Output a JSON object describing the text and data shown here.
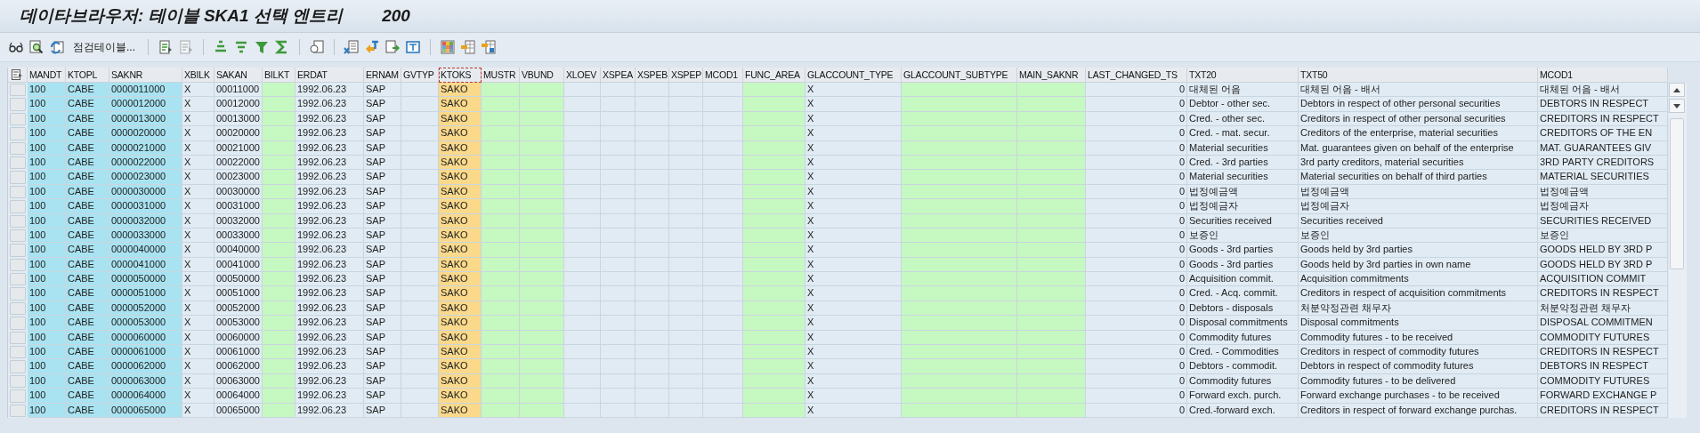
{
  "window": {
    "title": "데이타브라우저: 테이블 SKA1 선택 엔트리",
    "count": "200"
  },
  "toolbar": {
    "check_table_button": "점검테이블..."
  },
  "table": {
    "columns": [
      {
        "label": "MANDT",
        "kind": "key",
        "selected": false
      },
      {
        "label": "KTOPL",
        "kind": "key",
        "selected": false
      },
      {
        "label": "SAKNR",
        "kind": "key",
        "selected": false
      },
      {
        "label": "XBILK",
        "kind": "plain",
        "selected": false
      },
      {
        "label": "SAKAN",
        "kind": "plain",
        "selected": false
      },
      {
        "label": "BILKT",
        "kind": "input",
        "selected": false
      },
      {
        "label": "ERDAT",
        "kind": "plain",
        "selected": false
      },
      {
        "label": "ERNAM",
        "kind": "plain",
        "selected": false
      },
      {
        "label": "GVTYP",
        "kind": "plain",
        "selected": false
      },
      {
        "label": "KTOKS",
        "kind": "emphasized",
        "selected": true
      },
      {
        "label": "MUSTR",
        "kind": "input",
        "selected": false
      },
      {
        "label": "VBUND",
        "kind": "input",
        "selected": false
      },
      {
        "label": "XLOEV",
        "kind": "plain",
        "selected": false
      },
      {
        "label": "XSPEA",
        "kind": "plain",
        "selected": false
      },
      {
        "label": "XSPEB",
        "kind": "plain",
        "selected": false
      },
      {
        "label": "XSPEP",
        "kind": "plain",
        "selected": false
      },
      {
        "label": "MCOD1",
        "kind": "plain",
        "selected": false
      },
      {
        "label": "FUNC_AREA",
        "kind": "input",
        "selected": false
      },
      {
        "label": "GLACCOUNT_TYPE",
        "kind": "plain",
        "selected": false
      },
      {
        "label": "GLACCOUNT_SUBTYPE",
        "kind": "input",
        "selected": false
      },
      {
        "label": "MAIN_SAKNR",
        "kind": "input",
        "selected": false
      },
      {
        "label": "LAST_CHANGED_TS",
        "kind": "plain",
        "selected": false
      },
      {
        "label": "TXT20",
        "kind": "plain",
        "selected": false
      },
      {
        "label": "TXT50",
        "kind": "plain",
        "selected": false
      },
      {
        "label": "MCOD1",
        "kind": "plain",
        "selected": false
      }
    ],
    "rows": [
      {
        "mandt": "100",
        "ktopl": "CABE",
        "saknr": "0000011000",
        "xbilk": "X",
        "sakan": "00011000",
        "erdat": "1992.06.23",
        "ernam": "SAP",
        "ktoks": "SAKO",
        "glaccount_type": "X",
        "last_changed_ts": "0",
        "txt20": "대체된 어음",
        "txt50": "대체된 어음 - 배서",
        "mcod1": "대체된 어음 - 배서"
      },
      {
        "mandt": "100",
        "ktopl": "CABE",
        "saknr": "0000012000",
        "xbilk": "X",
        "sakan": "00012000",
        "erdat": "1992.06.23",
        "ernam": "SAP",
        "ktoks": "SAKO",
        "glaccount_type": "X",
        "last_changed_ts": "0",
        "txt20": "Debtor - other sec.",
        "txt50": "Debtors in respect of other personal securities",
        "mcod1": "DEBTORS IN RESPECT"
      },
      {
        "mandt": "100",
        "ktopl": "CABE",
        "saknr": "0000013000",
        "xbilk": "X",
        "sakan": "00013000",
        "erdat": "1992.06.23",
        "ernam": "SAP",
        "ktoks": "SAKO",
        "glaccount_type": "X",
        "last_changed_ts": "0",
        "txt20": "Cred. - other sec.",
        "txt50": "Creditors in respect of other personal securities",
        "mcod1": "CREDITORS IN RESPECT"
      },
      {
        "mandt": "100",
        "ktopl": "CABE",
        "saknr": "0000020000",
        "xbilk": "X",
        "sakan": "00020000",
        "erdat": "1992.06.23",
        "ernam": "SAP",
        "ktoks": "SAKO",
        "glaccount_type": "X",
        "last_changed_ts": "0",
        "txt20": "Cred. - mat. secur.",
        "txt50": "Creditors of the enterprise, material securities",
        "mcod1": "CREDITORS OF THE EN"
      },
      {
        "mandt": "100",
        "ktopl": "CABE",
        "saknr": "0000021000",
        "xbilk": "X",
        "sakan": "00021000",
        "erdat": "1992.06.23",
        "ernam": "SAP",
        "ktoks": "SAKO",
        "glaccount_type": "X",
        "last_changed_ts": "0",
        "txt20": "Material securities",
        "txt50": "Mat. guarantees given on behalf of the enterprise",
        "mcod1": "MAT. GUARANTEES GIV"
      },
      {
        "mandt": "100",
        "ktopl": "CABE",
        "saknr": "0000022000",
        "xbilk": "X",
        "sakan": "00022000",
        "erdat": "1992.06.23",
        "ernam": "SAP",
        "ktoks": "SAKO",
        "glaccount_type": "X",
        "last_changed_ts": "0",
        "txt20": "Cred. - 3rd parties",
        "txt50": "3rd party creditors, material securities",
        "mcod1": "3RD PARTY CREDITORS"
      },
      {
        "mandt": "100",
        "ktopl": "CABE",
        "saknr": "0000023000",
        "xbilk": "X",
        "sakan": "00023000",
        "erdat": "1992.06.23",
        "ernam": "SAP",
        "ktoks": "SAKO",
        "glaccount_type": "X",
        "last_changed_ts": "0",
        "txt20": "Material securities",
        "txt50": "Material securities on behalf of third parties",
        "mcod1": "MATERIAL SECURITIES"
      },
      {
        "mandt": "100",
        "ktopl": "CABE",
        "saknr": "0000030000",
        "xbilk": "X",
        "sakan": "00030000",
        "erdat": "1992.06.23",
        "ernam": "SAP",
        "ktoks": "SAKO",
        "glaccount_type": "X",
        "last_changed_ts": "0",
        "txt20": "법정예금액",
        "txt50": "법정예금액",
        "mcod1": "법정예금액"
      },
      {
        "mandt": "100",
        "ktopl": "CABE",
        "saknr": "0000031000",
        "xbilk": "X",
        "sakan": "00031000",
        "erdat": "1992.06.23",
        "ernam": "SAP",
        "ktoks": "SAKO",
        "glaccount_type": "X",
        "last_changed_ts": "0",
        "txt20": "법정예금자",
        "txt50": "법정예금자",
        "mcod1": "법정예금자"
      },
      {
        "mandt": "100",
        "ktopl": "CABE",
        "saknr": "0000032000",
        "xbilk": "X",
        "sakan": "00032000",
        "erdat": "1992.06.23",
        "ernam": "SAP",
        "ktoks": "SAKO",
        "glaccount_type": "X",
        "last_changed_ts": "0",
        "txt20": "Securities received",
        "txt50": "Securities received",
        "mcod1": "SECURITIES RECEIVED"
      },
      {
        "mandt": "100",
        "ktopl": "CABE",
        "saknr": "0000033000",
        "xbilk": "X",
        "sakan": "00033000",
        "erdat": "1992.06.23",
        "ernam": "SAP",
        "ktoks": "SAKO",
        "glaccount_type": "X",
        "last_changed_ts": "0",
        "txt20": "보증인",
        "txt50": "보증인",
        "mcod1": "보증인"
      },
      {
        "mandt": "100",
        "ktopl": "CABE",
        "saknr": "0000040000",
        "xbilk": "X",
        "sakan": "00040000",
        "erdat": "1992.06.23",
        "ernam": "SAP",
        "ktoks": "SAKO",
        "glaccount_type": "X",
        "last_changed_ts": "0",
        "txt20": "Goods - 3rd parties",
        "txt50": "Goods held by 3rd parties",
        "mcod1": "GOODS HELD BY 3RD P"
      },
      {
        "mandt": "100",
        "ktopl": "CABE",
        "saknr": "0000041000",
        "xbilk": "X",
        "sakan": "00041000",
        "erdat": "1992.06.23",
        "ernam": "SAP",
        "ktoks": "SAKO",
        "glaccount_type": "X",
        "last_changed_ts": "0",
        "txt20": "Goods - 3rd parties",
        "txt50": "Goods held by 3rd parties in own name",
        "mcod1": "GOODS HELD BY 3RD P"
      },
      {
        "mandt": "100",
        "ktopl": "CABE",
        "saknr": "0000050000",
        "xbilk": "X",
        "sakan": "00050000",
        "erdat": "1992.06.23",
        "ernam": "SAP",
        "ktoks": "SAKO",
        "glaccount_type": "X",
        "last_changed_ts": "0",
        "txt20": "Acquisition commit.",
        "txt50": "Acquisition commitments",
        "mcod1": "ACQUISITION COMMIT"
      },
      {
        "mandt": "100",
        "ktopl": "CABE",
        "saknr": "0000051000",
        "xbilk": "X",
        "sakan": "00051000",
        "erdat": "1992.06.23",
        "ernam": "SAP",
        "ktoks": "SAKO",
        "glaccount_type": "X",
        "last_changed_ts": "0",
        "txt20": "Cred. - Acq. commit.",
        "txt50": "Creditors in respect of acquisition commitments",
        "mcod1": "CREDITORS IN RESPECT"
      },
      {
        "mandt": "100",
        "ktopl": "CABE",
        "saknr": "0000052000",
        "xbilk": "X",
        "sakan": "00052000",
        "erdat": "1992.06.23",
        "ernam": "SAP",
        "ktoks": "SAKO",
        "glaccount_type": "X",
        "last_changed_ts": "0",
        "txt20": "Debtors - disposals",
        "txt50": "처분약정관련 채무자",
        "mcod1": "처분약정관련 채무자"
      },
      {
        "mandt": "100",
        "ktopl": "CABE",
        "saknr": "0000053000",
        "xbilk": "X",
        "sakan": "00053000",
        "erdat": "1992.06.23",
        "ernam": "SAP",
        "ktoks": "SAKO",
        "glaccount_type": "X",
        "last_changed_ts": "0",
        "txt20": "Disposal commitments",
        "txt50": "Disposal commitments",
        "mcod1": "DISPOSAL COMMITMEN"
      },
      {
        "mandt": "100",
        "ktopl": "CABE",
        "saknr": "0000060000",
        "xbilk": "X",
        "sakan": "00060000",
        "erdat": "1992.06.23",
        "ernam": "SAP",
        "ktoks": "SAKO",
        "glaccount_type": "X",
        "last_changed_ts": "0",
        "txt20": "Commodity futures",
        "txt50": "Commodity futures - to be received",
        "mcod1": "COMMODITY FUTURES"
      },
      {
        "mandt": "100",
        "ktopl": "CABE",
        "saknr": "0000061000",
        "xbilk": "X",
        "sakan": "00061000",
        "erdat": "1992.06.23",
        "ernam": "SAP",
        "ktoks": "SAKO",
        "glaccount_type": "X",
        "last_changed_ts": "0",
        "txt20": "Cred. - Commodities",
        "txt50": "Creditors in respect of commodity futures",
        "mcod1": "CREDITORS IN RESPECT"
      },
      {
        "mandt": "100",
        "ktopl": "CABE",
        "saknr": "0000062000",
        "xbilk": "X",
        "sakan": "00062000",
        "erdat": "1992.06.23",
        "ernam": "SAP",
        "ktoks": "SAKO",
        "glaccount_type": "X",
        "last_changed_ts": "0",
        "txt20": "Debtors - commodit.",
        "txt50": "Debtors in respect of commodity futures",
        "mcod1": "DEBTORS IN RESPECT"
      },
      {
        "mandt": "100",
        "ktopl": "CABE",
        "saknr": "0000063000",
        "xbilk": "X",
        "sakan": "00063000",
        "erdat": "1992.06.23",
        "ernam": "SAP",
        "ktoks": "SAKO",
        "glaccount_type": "X",
        "last_changed_ts": "0",
        "txt20": "Commodity futures",
        "txt50": "Commodity futures - to be delivered",
        "mcod1": "COMMODITY FUTURES"
      },
      {
        "mandt": "100",
        "ktopl": "CABE",
        "saknr": "0000064000",
        "xbilk": "X",
        "sakan": "00064000",
        "erdat": "1992.06.23",
        "ernam": "SAP",
        "ktoks": "SAKO",
        "glaccount_type": "X",
        "last_changed_ts": "0",
        "txt20": "Forward exch. purch.",
        "txt50": "Forward exchange purchases - to be received",
        "mcod1": "FORWARD EXCHANGE P"
      },
      {
        "mandt": "100",
        "ktopl": "CABE",
        "saknr": "0000065000",
        "xbilk": "X",
        "sakan": "00065000",
        "erdat": "1992.06.23",
        "ernam": "SAP",
        "ktoks": "SAKO",
        "glaccount_type": "X",
        "last_changed_ts": "0",
        "txt20": "Cred.-forward exch.",
        "txt50": "Creditors in respect of forward exchange purchas.",
        "mcod1": "CREDITORS IN RESPECT"
      }
    ]
  }
}
